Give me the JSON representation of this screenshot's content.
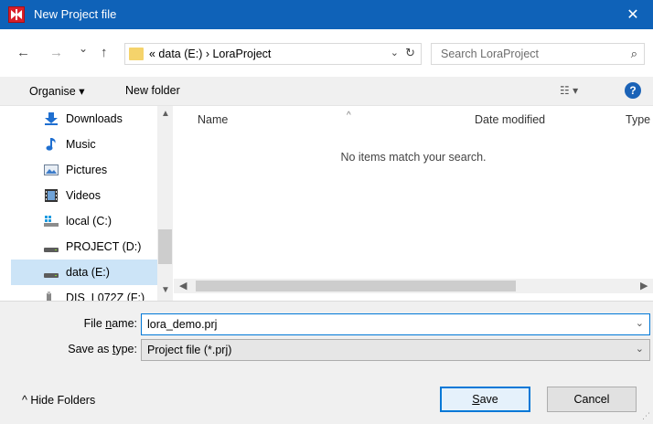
{
  "window": {
    "title": "New Project file",
    "close_glyph": "✕"
  },
  "nav": {
    "back_glyph": "←",
    "forward_glyph": "→",
    "recent_glyph": "⌄",
    "up_glyph": "↑",
    "address": "«  data (E:)  ›  LoraProject",
    "address_dd": "⌄",
    "refresh_glyph": "↻",
    "search_placeholder": "Search LoraProject",
    "search_glyph": "⌕"
  },
  "toolbar": {
    "organise": "Organise ▾",
    "new_folder": "New folder",
    "view_glyph": "☷ ▾",
    "help_glyph": "?"
  },
  "sidebar": {
    "items": [
      {
        "label": "Downloads",
        "icon": "download-icon"
      },
      {
        "label": "Music",
        "icon": "music-icon"
      },
      {
        "label": "Pictures",
        "icon": "pictures-icon"
      },
      {
        "label": "Videos",
        "icon": "videos-icon"
      },
      {
        "label": "local (C:)",
        "icon": "windows-drive-icon"
      },
      {
        "label": "PROJECT (D:)",
        "icon": "drive-icon"
      },
      {
        "label": "data (E:)",
        "icon": "drive-icon"
      },
      {
        "label": "DIS_L072Z (F:)",
        "icon": "usb-drive-icon"
      }
    ],
    "selected_index": 6
  },
  "filelist": {
    "columns": [
      "Name",
      "Date modified",
      "Type"
    ],
    "sort_glyph": "^",
    "empty_message": "No items match your search."
  },
  "form": {
    "filename_label_pre": "File ",
    "filename_label_u": "n",
    "filename_label_post": "ame:",
    "filename_value": "lora_demo.prj",
    "savetype_label_pre": "Save as ",
    "savetype_label_u": "t",
    "savetype_label_post": "ype:",
    "savetype_value": "Project file (*.prj)",
    "dropdown_glyph": "⌄"
  },
  "footer": {
    "hide_folders": "^  Hide Folders",
    "save_u": "S",
    "save_rest": "ave",
    "cancel": "Cancel"
  },
  "colors": {
    "titlebar": "#0f62b8",
    "selection": "#cce4f7",
    "accent": "#0078d7"
  }
}
